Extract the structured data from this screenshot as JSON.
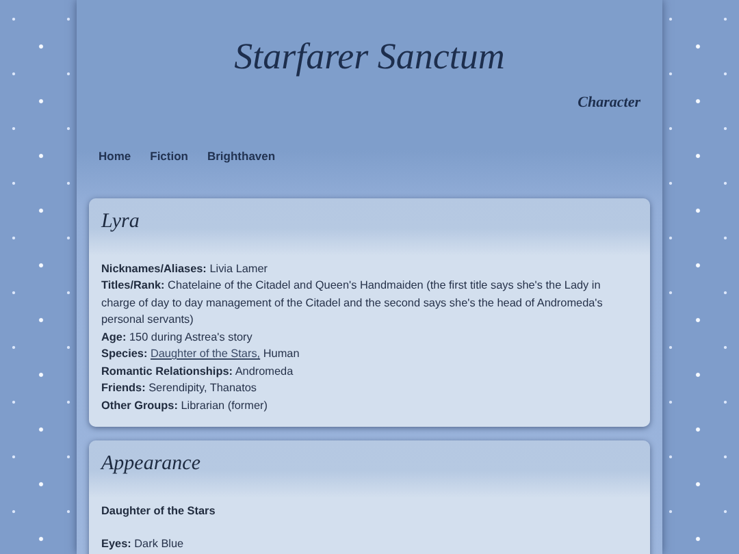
{
  "site": {
    "title": "Starfarer Sanctum",
    "subtitle": "Character"
  },
  "nav": [
    "Home",
    "Fiction",
    "Brighthaven"
  ],
  "sections": [
    {
      "heading": "Lyra",
      "items": [
        {
          "kind": "field",
          "label": "Nicknames/Aliases:",
          "parts": [
            {
              "kind": "text",
              "text": "Livia Lamer"
            }
          ]
        },
        {
          "kind": "field",
          "label": "Titles/Rank:",
          "parts": [
            {
              "kind": "text",
              "text": "Chatelaine of the Citadel and Queen's Handmaiden (the first title says she's the Lady in charge of day to day management of the Citadel and the second says she's the head of Andromeda's personal servants)"
            }
          ]
        },
        {
          "kind": "field",
          "label": "Age:",
          "parts": [
            {
              "kind": "text",
              "text": "150 during Astrea's story"
            }
          ]
        },
        {
          "kind": "field",
          "label": "Species:",
          "parts": [
            {
              "kind": "link",
              "text": "Daughter of the Stars,"
            },
            {
              "kind": "text",
              "text": "Human"
            }
          ]
        },
        {
          "kind": "field",
          "label": "Romantic Relationships:",
          "parts": [
            {
              "kind": "text",
              "text": "Andromeda"
            }
          ]
        },
        {
          "kind": "field",
          "label": "Friends:",
          "parts": [
            {
              "kind": "text",
              "text": "Serendipity, Thanatos"
            }
          ]
        },
        {
          "kind": "field",
          "label": "Other Groups:",
          "parts": [
            {
              "kind": "text",
              "text": "Librarian (former)"
            }
          ]
        }
      ]
    },
    {
      "heading": "Appearance",
      "items": [
        {
          "kind": "subheading",
          "text": "Daughter of the Stars"
        },
        {
          "kind": "field",
          "label": "Eyes:",
          "parts": [
            {
              "kind": "text",
              "text": "Dark Blue"
            }
          ]
        }
      ]
    }
  ]
}
